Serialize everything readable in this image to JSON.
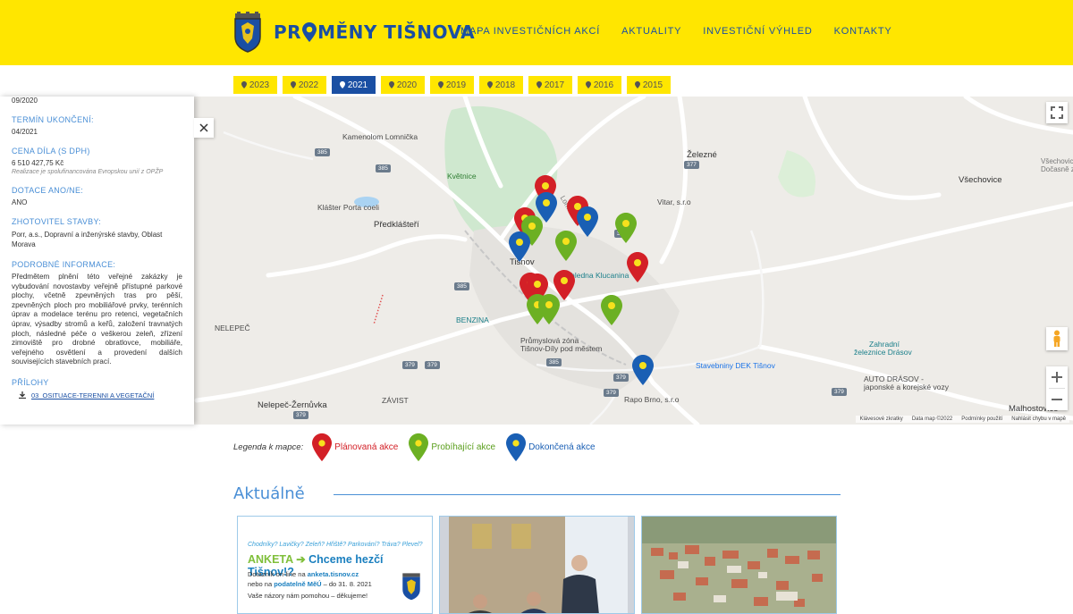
{
  "header": {
    "logo_prefix": "PR",
    "logo_suffix": "MĚNY TIŠNOVA",
    "nav": [
      "MAPA INVESTIČNÍCH AKCÍ",
      "AKTUALITY",
      "INVESTIČNÍ VÝHLED",
      "KONTAKTY"
    ]
  },
  "years": [
    "2023",
    "2022",
    "2021",
    "2020",
    "2019",
    "2018",
    "2017",
    "2016",
    "2015"
  ],
  "active_year": "2021",
  "panel": {
    "start_value": "09/2020",
    "end_label": "TERMÍN UKONČENÍ:",
    "end_value": "04/2021",
    "price_label": "CENA DÍLA (s DPH)",
    "price_value": "6 510 427,75 Kč",
    "price_note": "Realizace je spolufinancována Evropskou unií z OPŽP",
    "subsidy_label": "DOTACE ANO/NE:",
    "subsidy_value": "ANO",
    "contractor_label": "ZHOTOVITEL STAVBY:",
    "contractor_value": "Porr, a.s., Dopravní a inženýrské stavby, Oblast Morava",
    "details_label": "PODROBNÉ INFORMACE:",
    "details_text": "Předmětem plnění této veřejné zakázky je vybudování novostavby veřejně přístupné parkové plochy, včetně zpevněných tras pro pěší, zpevněných ploch pro mobiliářové prvky, terénních úprav a modelace terénu pro retenci, vegetačních úprav, výsadby stromů a keřů, založení travnatých ploch, následné péče o veškerou zeleň, zřízení zimoviště pro drobné obratlovce, mobiliáře, veřejného osvětlení a provedení dalších souvisejících stavebních prací.",
    "attachments_label": "PŘÍLOHY",
    "attachment_1": "03_OSITUACE-TERENNI A VEGETAČNÍ"
  },
  "map_labels": {
    "kamenolom": "Kamenolom Lomnička",
    "kvetnice": "Květnice",
    "klaster": "Klášter Porta coeli",
    "predklasteri": "Předklášteří",
    "zelezne": "Železné",
    "vsechovice": "Všechovice",
    "vsechovice_small": "Všechovic",
    "docasne": "Dočasně zav",
    "vitar": "Vitar, s.r.o",
    "tisnov": "Tišnov",
    "rozhledna": "Rozhledna Klucanina",
    "benzina": "BENZINA",
    "prumyslova1": "Průmyslová zóna",
    "prumyslova2": "Tišnov-Díly pod městem",
    "nelepec": "NELEPEČ",
    "zavist": "ZÁVIST",
    "nelepec_zernuvka": "Nelepeč-Žernůvka",
    "stavebniny": "Stavebniny DEK Tišnov",
    "rapo": "Rapo Brno, s.r.o",
    "zahradni1": "Zahradní",
    "zahradni2": "železnice Drásov",
    "auto1": "AUTO DRÁSOV -",
    "auto2": "japonské a korejské vozy",
    "malhostovice": "Malhostovice",
    "lomnicka": "Lomnická",
    "roads": [
      "385",
      "385",
      "377",
      "385",
      "379",
      "379",
      "385",
      "379",
      "379",
      "379",
      "379",
      "377"
    ]
  },
  "map_attribution": [
    "Klávesové zkratky",
    "Data map ©2022",
    "Podmínky použití",
    "Nahlásit chybu v mapě"
  ],
  "markers": [
    {
      "color": "red"
    },
    {
      "color": "blue"
    },
    {
      "color": "red"
    },
    {
      "color": "blue"
    },
    {
      "color": "red"
    },
    {
      "color": "green"
    },
    {
      "color": "blue"
    },
    {
      "color": "green"
    },
    {
      "color": "green"
    },
    {
      "color": "red"
    },
    {
      "color": "red"
    },
    {
      "color": "red"
    },
    {
      "color": "red"
    },
    {
      "color": "green"
    },
    {
      "color": "green"
    },
    {
      "color": "green"
    },
    {
      "color": "blue"
    }
  ],
  "marker_colors": {
    "red": "#d32027",
    "green": "#6cb023",
    "blue": "#1a5fb4",
    "dot": "#f7e11d"
  },
  "legend": {
    "title": "Legenda k mapce:",
    "planned": "Plánovaná akce",
    "ongoing": "Probíhající akce",
    "done": "Dokončená akce"
  },
  "news": {
    "title": "Aktuálně",
    "card1": {
      "line1": "Chodníky? Lavičky? Zeleň? Hřiště? Parkování? Tráva? Plevel?",
      "line2a": "ANKETA",
      "line2b": "Chceme hezčí Tišnov!?",
      "line3a": "Dotazník on-line na ",
      "line3b": "anketa.tisnov.cz",
      "line4a": "nebo na ",
      "line4b": "podatelně MěÚ",
      "line4c": " – do 31. 8. 2021",
      "line5": "Vaše názory nám pomohou – děkujeme!"
    }
  }
}
